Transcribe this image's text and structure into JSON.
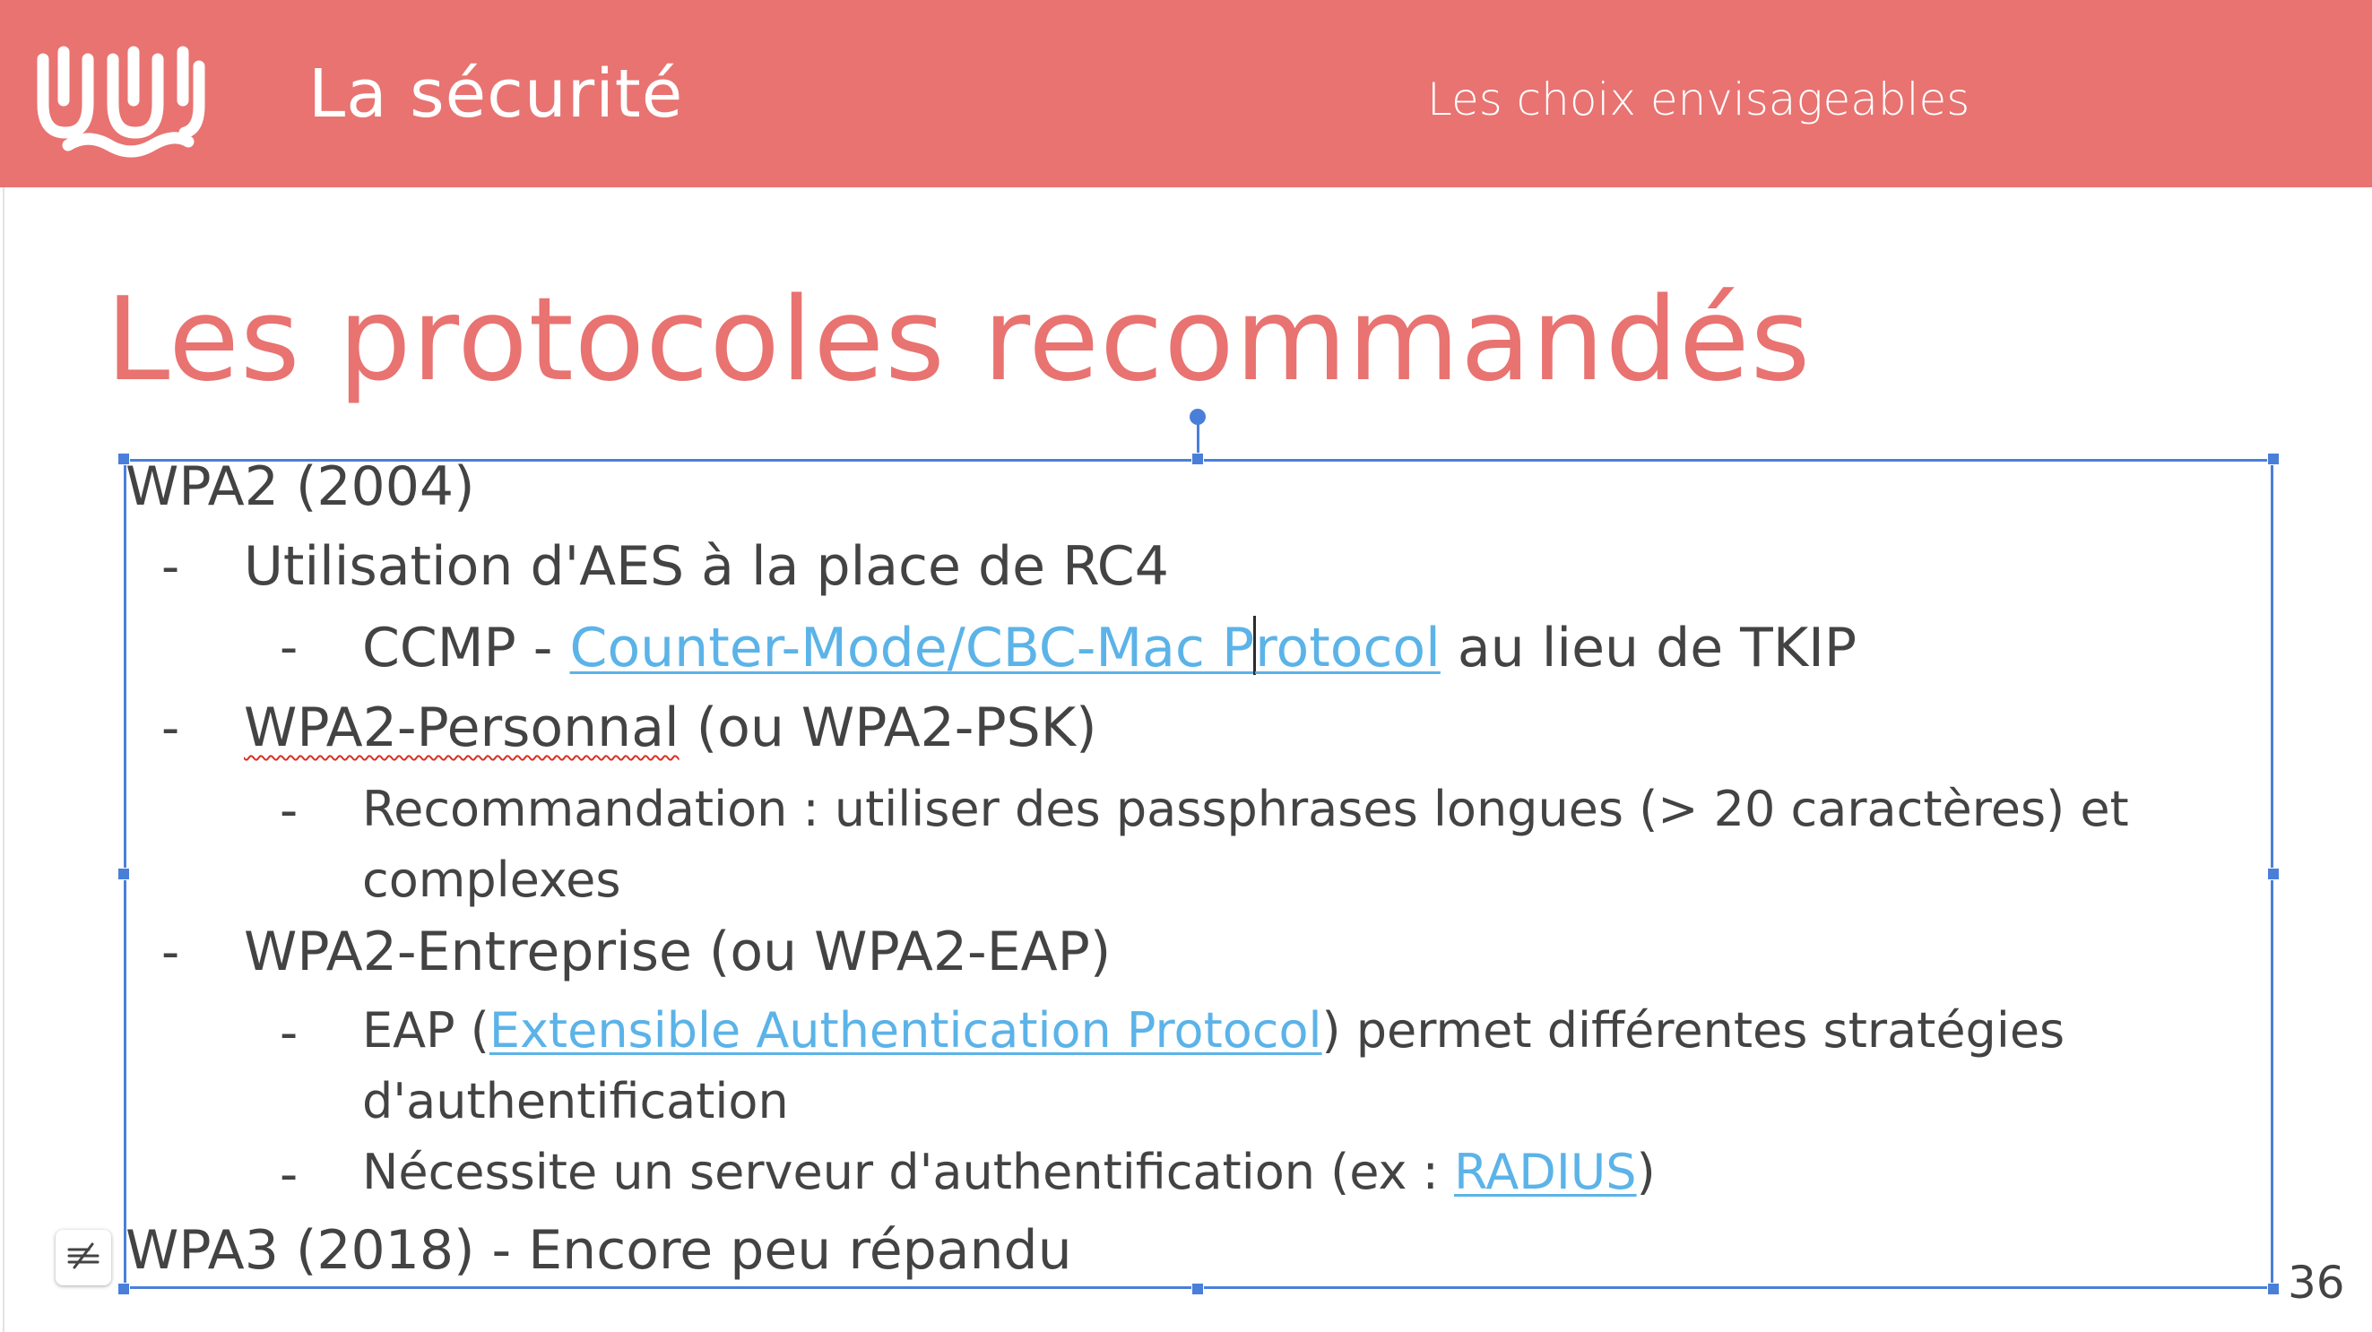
{
  "header": {
    "title": "La sécurité",
    "subtitle": "Les choix envisageables",
    "logo_icon": "uu-logo-icon",
    "background_color": "#e87371"
  },
  "slide": {
    "title": "Les protocoles recommandés",
    "page_number": "36"
  },
  "content": {
    "wpa2_heading": "WPA2 (2004)",
    "aes": "Utilisation d'AES à la place de RC4",
    "ccmp_prefix": "CCMP - ",
    "ccmp_link_a": "Counter-Mode/CBC-Mac P",
    "ccmp_link_b": "rotocol",
    "ccmp_suffix": " au lieu de TKIP",
    "personal_word": "WPA2-Personnal",
    "personal_rest": " (ou WPA2-PSK)",
    "recommandation_line1": "Recommandation : utiliser des passphrases longues (> 20 caractères) et",
    "recommandation_line2": "complexes",
    "entreprise": "WPA2-Entreprise (ou WPA2-EAP)",
    "eap_prefix": "EAP (",
    "eap_link": "Extensible Authentication Protocol",
    "eap_suffix": ") permet différentes stratégies",
    "eap_line2": "d'authentification",
    "radius_prefix": "Nécessite un serveur d'authentification (ex : ",
    "radius_link": "RADIUS",
    "radius_suffix": ")",
    "wpa3": "WPA3 (2018) - Encore peu répandu",
    "dash": "-"
  },
  "colors": {
    "accent": "#e87371",
    "link": "#5bb3e8",
    "selection": "#4a7fd9",
    "text": "#434343"
  }
}
